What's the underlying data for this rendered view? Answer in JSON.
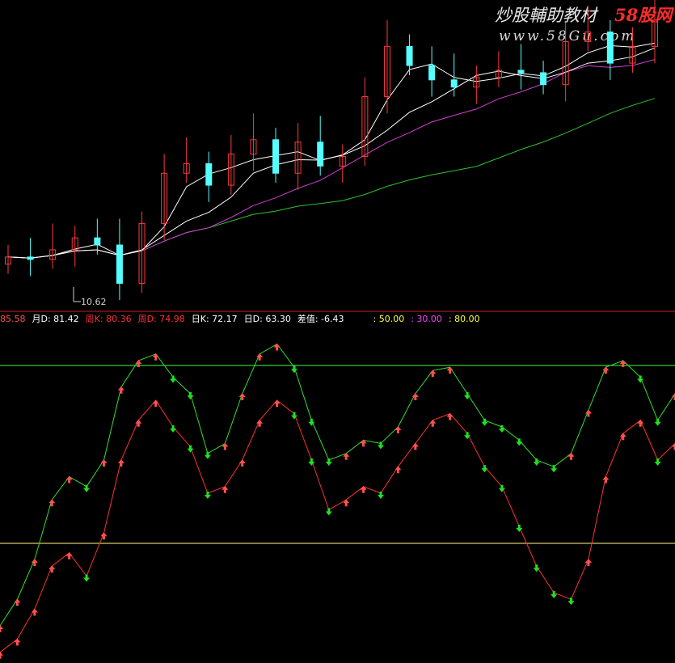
{
  "watermark": {
    "title": "炒股輔助教材",
    "brand": "58股网",
    "url": "www.58Gu.com"
  },
  "price_panel": {
    "low_label": "10.62"
  },
  "indicator_header": {
    "items": [
      {
        "text": "85.58",
        "color": "#ff5050"
      },
      {
        "text": "月D: 81.42",
        "color": "#ffffff"
      },
      {
        "text": "周K: 80.36",
        "color": "#ff3030"
      },
      {
        "text": "周D: 74.98",
        "color": "#ff3030"
      },
      {
        "text": "日K: 72.17",
        "color": "#ffffff"
      },
      {
        "text": "日D: 63.30",
        "color": "#ffffff"
      },
      {
        "text": "差值: -6.43",
        "color": "#ffffff"
      },
      {
        "text": ": 50.00",
        "color": "#ffff40"
      },
      {
        "text": ": 30.00",
        "color": "#ff40ff"
      },
      {
        "text": ": 80.00",
        "color": "#ffff40"
      }
    ]
  },
  "colors": {
    "background": "#000000",
    "up_candle": "#ff3a3a",
    "down_candle": "#54ffff",
    "ma5": "#ffffff",
    "ma10": "#ffffff",
    "ma20": "#d040d0",
    "ma60": "#30c030",
    "upper_line": "#40ff40",
    "lower_line": "#ffff80",
    "panel_separator": "#c81e1e",
    "kd_upper": "#30e030",
    "kd_lower": "#ff3030",
    "arrow_up": "#ff5050",
    "arrow_down": "#20e020"
  },
  "chart_data": [
    {
      "type": "candlestick",
      "title": "",
      "annotations": [
        "10.62"
      ],
      "series": [
        {
          "name": "",
          "values": [
            12.1,
            12.0,
            12.4,
            12.9,
            12.6,
            11.0,
            13.5,
            15.6,
            16.0,
            15.1,
            16.4,
            17.0,
            15.6,
            16.9,
            15.9,
            16.3,
            18.8,
            20.9,
            20.1,
            19.5,
            19.2,
            19.6,
            19.9,
            19.8,
            19.3,
            21.1,
            21.5,
            20.2,
            20.9,
            22.0
          ]
        }
      ]
    },
    {
      "type": "line",
      "title": "",
      "series": [
        {
          "name": "",
          "values": [
            10,
            18,
            30,
            48,
            55,
            52,
            60,
            82,
            90,
            92,
            85,
            80,
            62,
            65,
            80,
            92,
            95,
            88,
            72,
            60,
            62,
            66,
            65,
            70,
            80,
            87,
            88,
            80,
            72,
            70,
            66,
            60,
            58,
            62,
            75,
            88,
            90,
            85,
            72,
            80
          ]
        },
        {
          "name": "",
          "values": [
            2,
            6,
            15,
            28,
            32,
            25,
            38,
            60,
            72,
            78,
            70,
            64,
            50,
            52,
            60,
            72,
            78,
            74,
            60,
            45,
            48,
            52,
            50,
            58,
            65,
            72,
            74,
            68,
            58,
            52,
            40,
            28,
            20,
            18,
            30,
            55,
            68,
            72,
            60,
            65
          ]
        }
      ],
      "reference_lines": [
        80,
        30
      ]
    }
  ]
}
